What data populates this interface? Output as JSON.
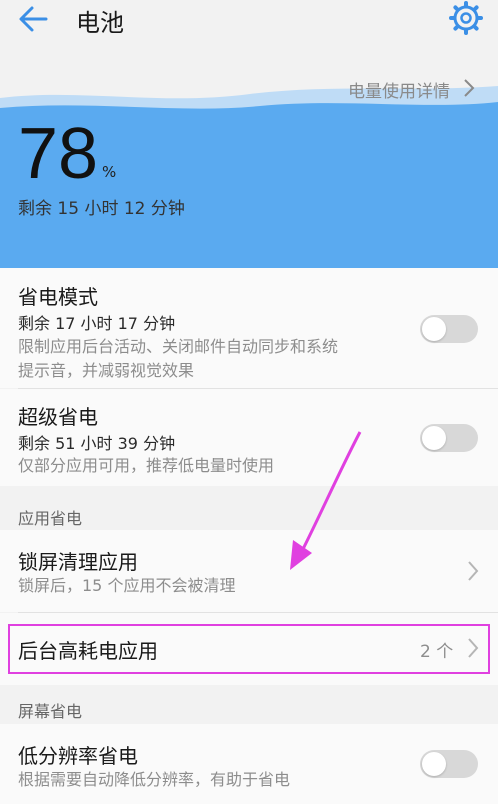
{
  "header": {
    "title": "电池",
    "back_icon": "back-arrow-icon",
    "settings_icon": "gear-icon"
  },
  "battery": {
    "details_link": "电量使用详情",
    "percent": "78",
    "percent_unit": "%",
    "remaining": "剩余 15 小时 12 分钟",
    "level": 78,
    "accent": "#5aaaf0"
  },
  "power_saving": {
    "title": "省电模式",
    "remaining": "剩余 17 小时 17 分钟",
    "desc_line1": "限制应用后台活动、关闭邮件自动同步和系统",
    "desc_line2": "提示音，并减弱视觉效果",
    "enabled": false
  },
  "ultra_saving": {
    "title": "超级省电",
    "remaining": "剩余 51 小时 39 分钟",
    "desc": "仅部分应用可用，推荐低电量时使用",
    "enabled": false
  },
  "app_section": {
    "header": "应用省电"
  },
  "lockscreen_cleanup": {
    "title": "锁屏清理应用",
    "desc": "锁屏后，15 个应用不会被清理"
  },
  "background_apps": {
    "title": "后台高耗电应用",
    "count": "2 个"
  },
  "screen_section": {
    "header": "屏幕省电"
  },
  "low_resolution": {
    "title": "低分辨率省电",
    "desc": "根据需要自动降低分辨率，有助于省电"
  },
  "annotation_color": "#e040e0"
}
